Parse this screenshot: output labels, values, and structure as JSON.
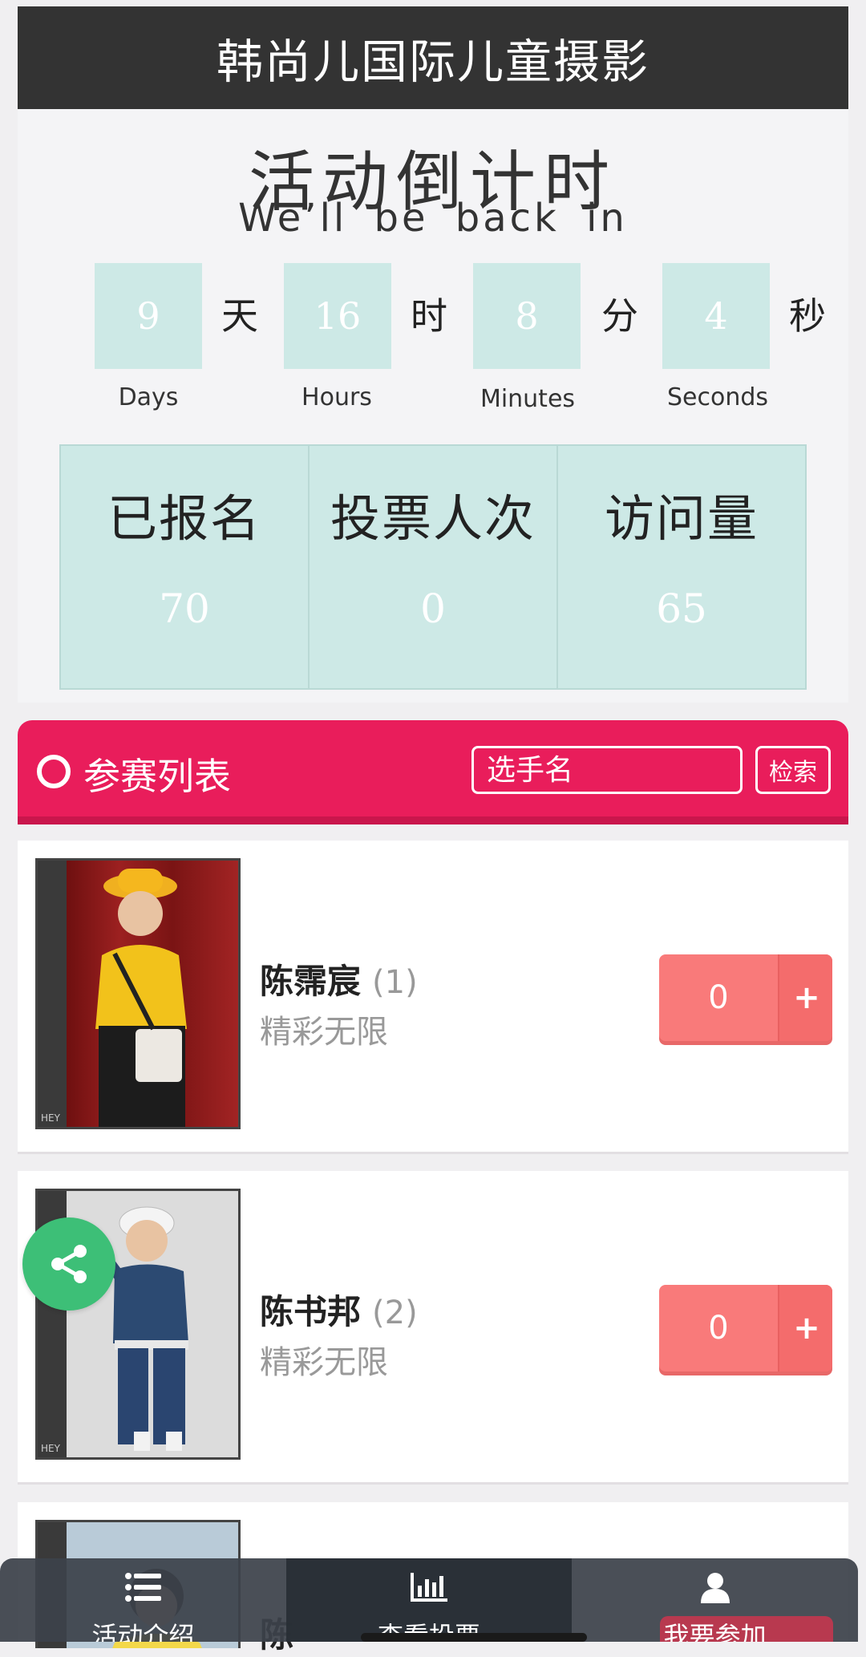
{
  "header": {
    "title": "韩尚儿国际儿童摄影"
  },
  "countdown": {
    "title": "活动倒计时",
    "subtitle": "We’ll be back in",
    "days": {
      "value": "9",
      "unit": "天",
      "label": "Days"
    },
    "hours": {
      "value": "16",
      "unit": "时",
      "label": "Hours"
    },
    "minutes": {
      "value": "8",
      "unit": "分",
      "label": "Minutes"
    },
    "seconds": {
      "value": "4",
      "unit": "秒",
      "label": "Seconds"
    }
  },
  "stats": [
    {
      "label": "已报名",
      "value": "70"
    },
    {
      "label": "投票人次",
      "value": "0"
    },
    {
      "label": "访问量",
      "value": "65"
    }
  ],
  "list_bar": {
    "title": "参赛列表",
    "search_placeholder": "选手名",
    "search_button": "检索"
  },
  "contestants": [
    {
      "name": "陈霈宸",
      "number": "(1)",
      "desc": "精彩无限",
      "votes": "0",
      "plus": "+",
      "photo_tag": "HEY",
      "bg": "#8b1a1a",
      "shirt": "#f2c21b"
    },
    {
      "name": "陈书邦",
      "number": "(2)",
      "desc": "精彩无限",
      "votes": "0",
      "plus": "+",
      "photo_tag": "HEY",
      "bg": "#dcdcdc",
      "shirt": "#2c4a72"
    },
    {
      "name": "陈",
      "number": "",
      "desc": "",
      "votes": "",
      "plus": "",
      "photo_tag": "",
      "bg": "#b9cbd8",
      "shirt": "#f3d84a"
    }
  ],
  "bottom_nav": [
    {
      "label": "活动介绍",
      "icon": "list-icon"
    },
    {
      "label": "查看投票",
      "icon": "bar-chart-icon"
    },
    {
      "label": "我要参加",
      "icon": "user-icon"
    }
  ],
  "colors": {
    "header": "#333333",
    "teal_box": "#cde9e6",
    "accent_pink": "#e91d5b",
    "vote_button": "#f97a7a",
    "share_green": "#3dbf77"
  }
}
